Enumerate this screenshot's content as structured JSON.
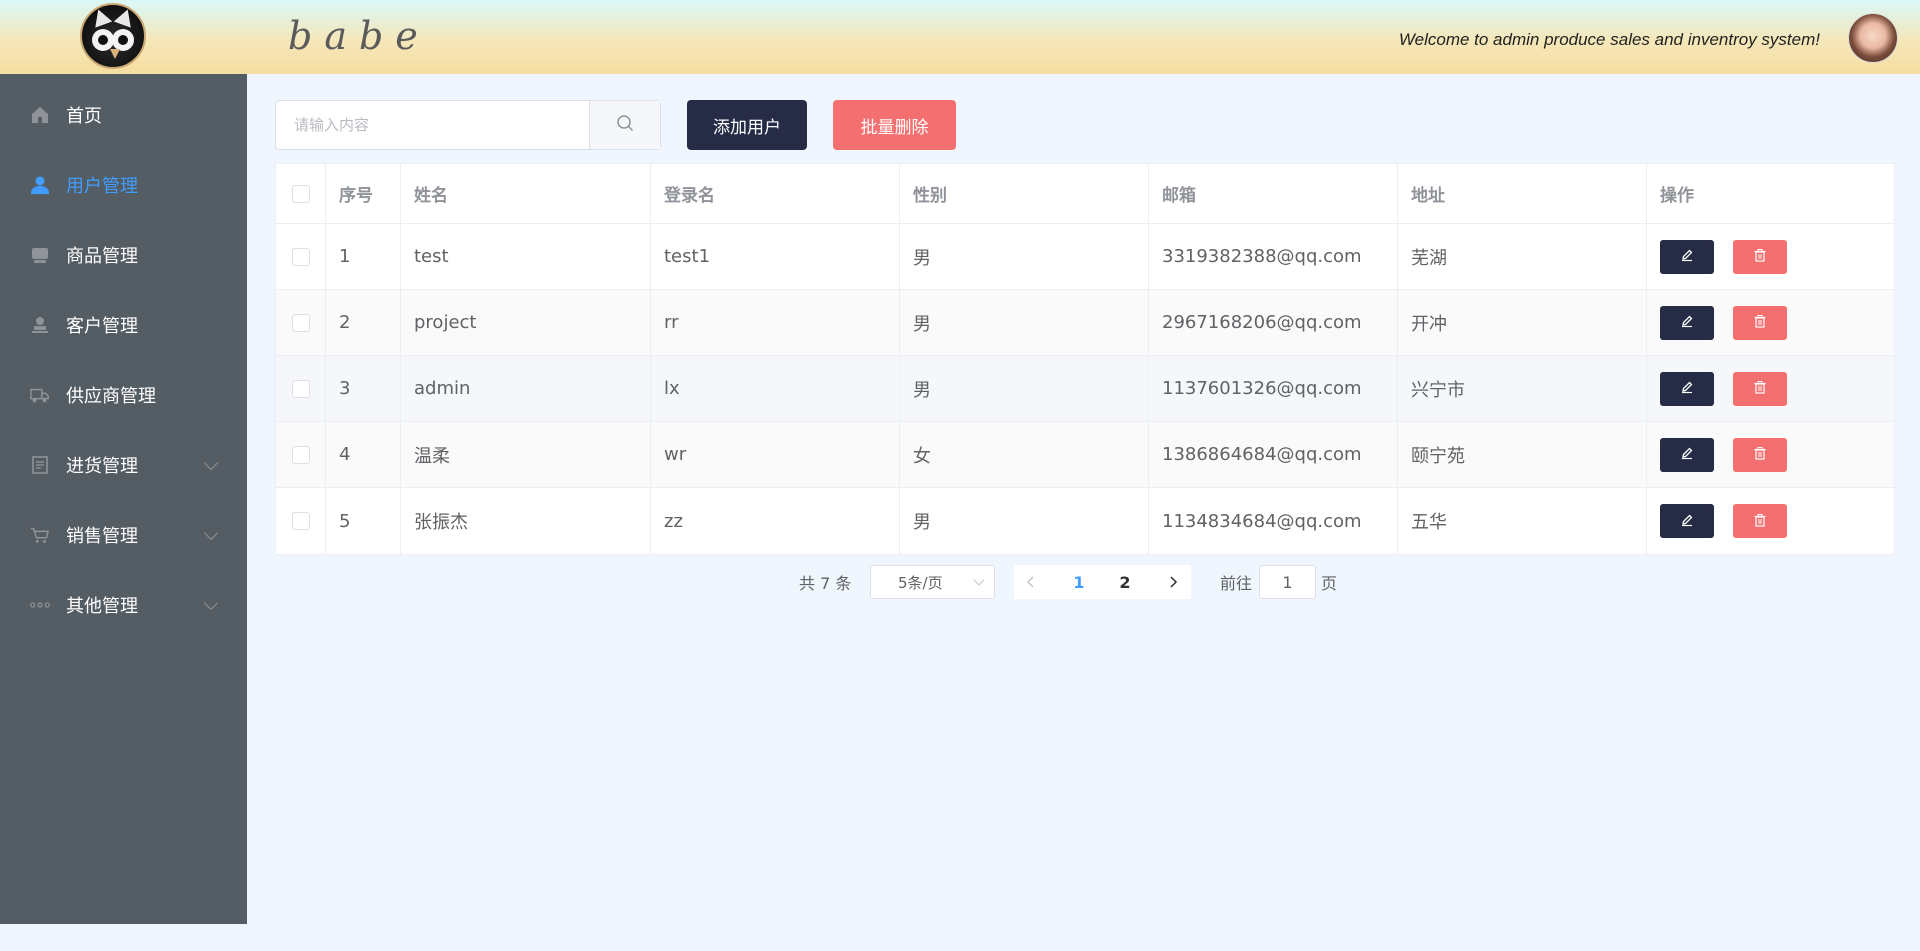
{
  "header": {
    "brand": "babe",
    "welcome": "Welcome to admin produce sales and inventroy system!"
  },
  "sidebar": {
    "items": [
      {
        "label": "首页",
        "icon": "home-icon",
        "active": false,
        "submenu": false
      },
      {
        "label": "用户管理",
        "icon": "user-icon",
        "active": true,
        "submenu": false
      },
      {
        "label": "商品管理",
        "icon": "goods-icon",
        "active": false,
        "submenu": false
      },
      {
        "label": "客户管理",
        "icon": "customer-icon",
        "active": false,
        "submenu": false
      },
      {
        "label": "供应商管理",
        "icon": "truck-icon",
        "active": false,
        "submenu": false
      },
      {
        "label": "进货管理",
        "icon": "document-icon",
        "active": false,
        "submenu": true
      },
      {
        "label": "销售管理",
        "icon": "cart-icon",
        "active": false,
        "submenu": true
      },
      {
        "label": "其他管理",
        "icon": "more-icon",
        "active": false,
        "submenu": true
      }
    ]
  },
  "toolbar": {
    "search_placeholder": "请输入内容",
    "add_label": "添加用户",
    "batch_delete_label": "批量删除"
  },
  "table": {
    "columns": [
      "序号",
      "姓名",
      "登录名",
      "性别",
      "邮箱",
      "地址",
      "操作"
    ],
    "rows": [
      {
        "no": "1",
        "name": "test",
        "login": "test1",
        "gender": "男",
        "email": "3319382388@qq.com",
        "address": "芜湖"
      },
      {
        "no": "2",
        "name": "project",
        "login": "rr",
        "gender": "男",
        "email": "2967168206@qq.com",
        "address": "开冲"
      },
      {
        "no": "3",
        "name": "admin",
        "login": "lx",
        "gender": "男",
        "email": "1137601326@qq.com",
        "address": "兴宁市"
      },
      {
        "no": "4",
        "name": "温柔",
        "login": "wr",
        "gender": "女",
        "email": "1386864684@qq.com",
        "address": "颐宁苑"
      },
      {
        "no": "5",
        "name": "张振杰",
        "login": "zz",
        "gender": "男",
        "email": "1134834684@qq.com",
        "address": "五华"
      }
    ]
  },
  "pagination": {
    "total_text": "共 7 条",
    "page_size": "5条/页",
    "pages": [
      "1",
      "2"
    ],
    "current_page": "1",
    "goto_label": "前往",
    "goto_value": "1",
    "goto_suffix": "页"
  },
  "colors": {
    "sidebar_bg": "#545c64",
    "active": "#409eff",
    "primary_dark": "#262c46",
    "danger": "#f46f6f"
  }
}
